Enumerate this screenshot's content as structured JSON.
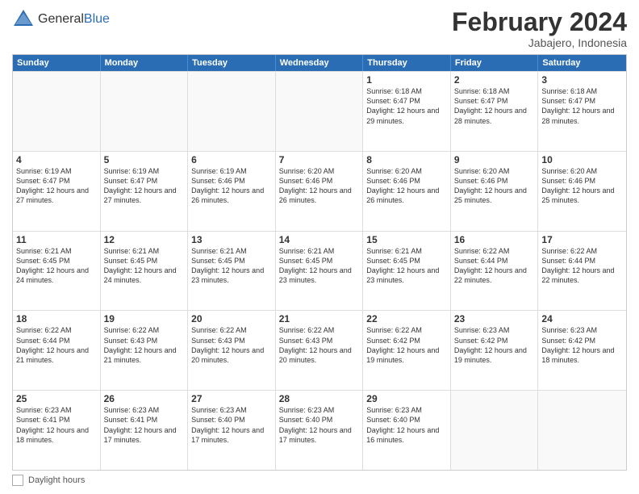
{
  "header": {
    "logo_general": "General",
    "logo_blue": "Blue",
    "main_title": "February 2024",
    "subtitle": "Jabajero, Indonesia"
  },
  "calendar": {
    "days_of_week": [
      "Sunday",
      "Monday",
      "Tuesday",
      "Wednesday",
      "Thursday",
      "Friday",
      "Saturday"
    ],
    "rows": [
      [
        {
          "num": "",
          "info": ""
        },
        {
          "num": "",
          "info": ""
        },
        {
          "num": "",
          "info": ""
        },
        {
          "num": "",
          "info": ""
        },
        {
          "num": "1",
          "info": "Sunrise: 6:18 AM\nSunset: 6:47 PM\nDaylight: 12 hours and 29 minutes."
        },
        {
          "num": "2",
          "info": "Sunrise: 6:18 AM\nSunset: 6:47 PM\nDaylight: 12 hours and 28 minutes."
        },
        {
          "num": "3",
          "info": "Sunrise: 6:18 AM\nSunset: 6:47 PM\nDaylight: 12 hours and 28 minutes."
        }
      ],
      [
        {
          "num": "4",
          "info": "Sunrise: 6:19 AM\nSunset: 6:47 PM\nDaylight: 12 hours and 27 minutes."
        },
        {
          "num": "5",
          "info": "Sunrise: 6:19 AM\nSunset: 6:47 PM\nDaylight: 12 hours and 27 minutes."
        },
        {
          "num": "6",
          "info": "Sunrise: 6:19 AM\nSunset: 6:46 PM\nDaylight: 12 hours and 26 minutes."
        },
        {
          "num": "7",
          "info": "Sunrise: 6:20 AM\nSunset: 6:46 PM\nDaylight: 12 hours and 26 minutes."
        },
        {
          "num": "8",
          "info": "Sunrise: 6:20 AM\nSunset: 6:46 PM\nDaylight: 12 hours and 26 minutes."
        },
        {
          "num": "9",
          "info": "Sunrise: 6:20 AM\nSunset: 6:46 PM\nDaylight: 12 hours and 25 minutes."
        },
        {
          "num": "10",
          "info": "Sunrise: 6:20 AM\nSunset: 6:46 PM\nDaylight: 12 hours and 25 minutes."
        }
      ],
      [
        {
          "num": "11",
          "info": "Sunrise: 6:21 AM\nSunset: 6:45 PM\nDaylight: 12 hours and 24 minutes."
        },
        {
          "num": "12",
          "info": "Sunrise: 6:21 AM\nSunset: 6:45 PM\nDaylight: 12 hours and 24 minutes."
        },
        {
          "num": "13",
          "info": "Sunrise: 6:21 AM\nSunset: 6:45 PM\nDaylight: 12 hours and 23 minutes."
        },
        {
          "num": "14",
          "info": "Sunrise: 6:21 AM\nSunset: 6:45 PM\nDaylight: 12 hours and 23 minutes."
        },
        {
          "num": "15",
          "info": "Sunrise: 6:21 AM\nSunset: 6:45 PM\nDaylight: 12 hours and 23 minutes."
        },
        {
          "num": "16",
          "info": "Sunrise: 6:22 AM\nSunset: 6:44 PM\nDaylight: 12 hours and 22 minutes."
        },
        {
          "num": "17",
          "info": "Sunrise: 6:22 AM\nSunset: 6:44 PM\nDaylight: 12 hours and 22 minutes."
        }
      ],
      [
        {
          "num": "18",
          "info": "Sunrise: 6:22 AM\nSunset: 6:44 PM\nDaylight: 12 hours and 21 minutes."
        },
        {
          "num": "19",
          "info": "Sunrise: 6:22 AM\nSunset: 6:43 PM\nDaylight: 12 hours and 21 minutes."
        },
        {
          "num": "20",
          "info": "Sunrise: 6:22 AM\nSunset: 6:43 PM\nDaylight: 12 hours and 20 minutes."
        },
        {
          "num": "21",
          "info": "Sunrise: 6:22 AM\nSunset: 6:43 PM\nDaylight: 12 hours and 20 minutes."
        },
        {
          "num": "22",
          "info": "Sunrise: 6:22 AM\nSunset: 6:42 PM\nDaylight: 12 hours and 19 minutes."
        },
        {
          "num": "23",
          "info": "Sunrise: 6:23 AM\nSunset: 6:42 PM\nDaylight: 12 hours and 19 minutes."
        },
        {
          "num": "24",
          "info": "Sunrise: 6:23 AM\nSunset: 6:42 PM\nDaylight: 12 hours and 18 minutes."
        }
      ],
      [
        {
          "num": "25",
          "info": "Sunrise: 6:23 AM\nSunset: 6:41 PM\nDaylight: 12 hours and 18 minutes."
        },
        {
          "num": "26",
          "info": "Sunrise: 6:23 AM\nSunset: 6:41 PM\nDaylight: 12 hours and 17 minutes."
        },
        {
          "num": "27",
          "info": "Sunrise: 6:23 AM\nSunset: 6:40 PM\nDaylight: 12 hours and 17 minutes."
        },
        {
          "num": "28",
          "info": "Sunrise: 6:23 AM\nSunset: 6:40 PM\nDaylight: 12 hours and 17 minutes."
        },
        {
          "num": "29",
          "info": "Sunrise: 6:23 AM\nSunset: 6:40 PM\nDaylight: 12 hours and 16 minutes."
        },
        {
          "num": "",
          "info": ""
        },
        {
          "num": "",
          "info": ""
        }
      ]
    ]
  },
  "footer": {
    "daylight_label": "Daylight hours"
  }
}
